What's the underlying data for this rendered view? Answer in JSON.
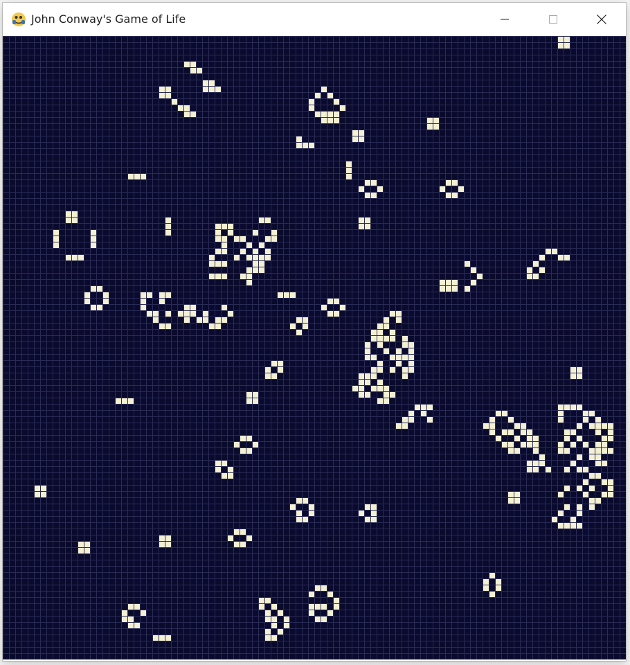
{
  "window": {
    "title": "John Conway's Game of Life",
    "app_icon": "python-icon"
  },
  "controls": {
    "minimize_icon": "minimize-icon",
    "maximize_icon": "maximize-icon",
    "close_icon": "close-icon"
  },
  "board": {
    "cols": 100,
    "rows": 100,
    "background_color": "#0a0a2e",
    "grid_color": "#2a2b55",
    "live_cell_color": "#f4f0d4",
    "live_cells": [
      [
        90,
        0
      ],
      [
        89,
        0
      ],
      [
        89,
        1
      ],
      [
        90,
        1
      ],
      [
        29,
        4
      ],
      [
        30,
        4
      ],
      [
        30,
        5
      ],
      [
        31,
        5
      ],
      [
        32,
        7
      ],
      [
        33,
        7
      ],
      [
        32,
        8
      ],
      [
        33,
        8
      ],
      [
        34,
        8
      ],
      [
        25,
        8
      ],
      [
        26,
        8
      ],
      [
        25,
        9
      ],
      [
        26,
        9
      ],
      [
        27,
        10
      ],
      [
        28,
        11
      ],
      [
        29,
        11
      ],
      [
        29,
        12
      ],
      [
        30,
        12
      ],
      [
        51,
        8
      ],
      [
        50,
        9
      ],
      [
        52,
        9
      ],
      [
        49,
        10
      ],
      [
        53,
        10
      ],
      [
        54,
        11
      ],
      [
        49,
        11
      ],
      [
        50,
        12
      ],
      [
        51,
        12
      ],
      [
        52,
        12
      ],
      [
        53,
        12
      ],
      [
        51,
        13
      ],
      [
        52,
        13
      ],
      [
        53,
        13
      ],
      [
        56,
        15
      ],
      [
        57,
        15
      ],
      [
        56,
        16
      ],
      [
        57,
        16
      ],
      [
        68,
        13
      ],
      [
        69,
        13
      ],
      [
        68,
        14
      ],
      [
        69,
        14
      ],
      [
        47,
        16
      ],
      [
        47,
        17
      ],
      [
        48,
        17
      ],
      [
        49,
        17
      ],
      [
        20,
        22
      ],
      [
        21,
        22
      ],
      [
        22,
        22
      ],
      [
        55,
        20
      ],
      [
        55,
        21
      ],
      [
        55,
        22
      ],
      [
        58,
        23
      ],
      [
        59,
        23
      ],
      [
        57,
        24
      ],
      [
        60,
        24
      ],
      [
        58,
        25
      ],
      [
        59,
        25
      ],
      [
        71,
        23
      ],
      [
        72,
        23
      ],
      [
        70,
        24
      ],
      [
        73,
        24
      ],
      [
        71,
        25
      ],
      [
        72,
        25
      ],
      [
        10,
        28
      ],
      [
        11,
        28
      ],
      [
        10,
        29
      ],
      [
        11,
        29
      ],
      [
        8,
        31
      ],
      [
        8,
        32
      ],
      [
        8,
        33
      ],
      [
        14,
        31
      ],
      [
        14,
        32
      ],
      [
        14,
        33
      ],
      [
        10,
        35
      ],
      [
        11,
        35
      ],
      [
        12,
        35
      ],
      [
        26,
        29
      ],
      [
        26,
        30
      ],
      [
        26,
        31
      ],
      [
        57,
        29
      ],
      [
        58,
        29
      ],
      [
        57,
        30
      ],
      [
        58,
        30
      ],
      [
        34,
        30
      ],
      [
        35,
        30
      ],
      [
        36,
        30
      ],
      [
        41,
        29
      ],
      [
        42,
        29
      ],
      [
        34,
        31
      ],
      [
        36,
        31
      ],
      [
        40,
        31
      ],
      [
        43,
        31
      ],
      [
        34,
        32
      ],
      [
        35,
        32
      ],
      [
        37,
        32
      ],
      [
        38,
        32
      ],
      [
        42,
        32
      ],
      [
        43,
        32
      ],
      [
        35,
        33
      ],
      [
        39,
        33
      ],
      [
        41,
        33
      ],
      [
        34,
        34
      ],
      [
        35,
        34
      ],
      [
        38,
        34
      ],
      [
        40,
        34
      ],
      [
        42,
        34
      ],
      [
        33,
        35
      ],
      [
        37,
        35
      ],
      [
        39,
        35
      ],
      [
        40,
        35
      ],
      [
        41,
        35
      ],
      [
        42,
        35
      ],
      [
        33,
        36
      ],
      [
        34,
        36
      ],
      [
        35,
        36
      ],
      [
        40,
        36
      ],
      [
        41,
        36
      ],
      [
        39,
        37
      ],
      [
        40,
        37
      ],
      [
        41,
        37
      ],
      [
        33,
        38
      ],
      [
        34,
        38
      ],
      [
        35,
        38
      ],
      [
        38,
        38
      ],
      [
        39,
        38
      ],
      [
        39,
        39
      ],
      [
        87,
        34
      ],
      [
        88,
        34
      ],
      [
        86,
        35
      ],
      [
        89,
        35
      ],
      [
        90,
        35
      ],
      [
        85,
        36
      ],
      [
        84,
        37
      ],
      [
        86,
        37
      ],
      [
        84,
        38
      ],
      [
        85,
        38
      ],
      [
        74,
        36
      ],
      [
        75,
        37
      ],
      [
        76,
        38
      ],
      [
        75,
        39
      ],
      [
        74,
        40
      ],
      [
        70,
        39
      ],
      [
        71,
        39
      ],
      [
        72,
        39
      ],
      [
        70,
        40
      ],
      [
        71,
        40
      ],
      [
        72,
        40
      ],
      [
        14,
        40
      ],
      [
        15,
        40
      ],
      [
        13,
        41
      ],
      [
        16,
        41
      ],
      [
        13,
        42
      ],
      [
        16,
        42
      ],
      [
        14,
        43
      ],
      [
        15,
        43
      ],
      [
        22,
        41
      ],
      [
        23,
        41
      ],
      [
        25,
        41
      ],
      [
        26,
        41
      ],
      [
        22,
        42
      ],
      [
        25,
        42
      ],
      [
        22,
        43
      ],
      [
        29,
        43
      ],
      [
        30,
        43
      ],
      [
        35,
        43
      ],
      [
        23,
        44
      ],
      [
        24,
        44
      ],
      [
        26,
        44
      ],
      [
        28,
        44
      ],
      [
        29,
        44
      ],
      [
        30,
        44
      ],
      [
        32,
        44
      ],
      [
        36,
        44
      ],
      [
        24,
        45
      ],
      [
        32,
        45
      ],
      [
        35,
        45
      ],
      [
        29,
        45
      ],
      [
        31,
        45
      ],
      [
        34,
        45
      ],
      [
        25,
        46
      ],
      [
        26,
        46
      ],
      [
        33,
        46
      ],
      [
        34,
        46
      ],
      [
        44,
        41
      ],
      [
        45,
        41
      ],
      [
        46,
        41
      ],
      [
        52,
        42
      ],
      [
        53,
        42
      ],
      [
        51,
        43
      ],
      [
        54,
        43
      ],
      [
        52,
        44
      ],
      [
        53,
        44
      ],
      [
        47,
        45
      ],
      [
        48,
        45
      ],
      [
        46,
        46
      ],
      [
        48,
        46
      ],
      [
        47,
        47
      ],
      [
        62,
        44
      ],
      [
        63,
        44
      ],
      [
        61,
        45
      ],
      [
        63,
        45
      ],
      [
        60,
        46
      ],
      [
        61,
        46
      ],
      [
        59,
        47
      ],
      [
        60,
        47
      ],
      [
        62,
        47
      ],
      [
        59,
        48
      ],
      [
        60,
        48
      ],
      [
        61,
        48
      ],
      [
        62,
        48
      ],
      [
        64,
        48
      ],
      [
        58,
        49
      ],
      [
        60,
        49
      ],
      [
        64,
        49
      ],
      [
        65,
        49
      ],
      [
        58,
        50
      ],
      [
        61,
        50
      ],
      [
        63,
        50
      ],
      [
        65,
        50
      ],
      [
        58,
        51
      ],
      [
        59,
        51
      ],
      [
        62,
        51
      ],
      [
        63,
        51
      ],
      [
        64,
        51
      ],
      [
        65,
        51
      ],
      [
        60,
        52
      ],
      [
        63,
        52
      ],
      [
        65,
        52
      ],
      [
        59,
        53
      ],
      [
        60,
        53
      ],
      [
        62,
        53
      ],
      [
        64,
        53
      ],
      [
        65,
        53
      ],
      [
        57,
        54
      ],
      [
        58,
        54
      ],
      [
        59,
        54
      ],
      [
        64,
        54
      ],
      [
        57,
        55
      ],
      [
        58,
        55
      ],
      [
        60,
        55
      ],
      [
        56,
        56
      ],
      [
        57,
        56
      ],
      [
        59,
        56
      ],
      [
        60,
        56
      ],
      [
        61,
        56
      ],
      [
        57,
        57
      ],
      [
        58,
        57
      ],
      [
        61,
        57
      ],
      [
        62,
        57
      ],
      [
        60,
        58
      ],
      [
        61,
        58
      ],
      [
        43,
        52
      ],
      [
        44,
        52
      ],
      [
        42,
        53
      ],
      [
        44,
        53
      ],
      [
        42,
        54
      ],
      [
        43,
        54
      ],
      [
        91,
        53
      ],
      [
        92,
        53
      ],
      [
        91,
        54
      ],
      [
        92,
        54
      ],
      [
        18,
        58
      ],
      [
        19,
        58
      ],
      [
        20,
        58
      ],
      [
        39,
        57
      ],
      [
        40,
        57
      ],
      [
        39,
        58
      ],
      [
        40,
        58
      ],
      [
        66,
        59
      ],
      [
        67,
        59
      ],
      [
        68,
        59
      ],
      [
        65,
        60
      ],
      [
        67,
        60
      ],
      [
        64,
        61
      ],
      [
        65,
        61
      ],
      [
        68,
        61
      ],
      [
        63,
        62
      ],
      [
        64,
        62
      ],
      [
        79,
        60
      ],
      [
        80,
        60
      ],
      [
        78,
        61
      ],
      [
        81,
        61
      ],
      [
        77,
        62
      ],
      [
        78,
        62
      ],
      [
        82,
        62
      ],
      [
        83,
        62
      ],
      [
        78,
        63
      ],
      [
        80,
        63
      ],
      [
        81,
        63
      ],
      [
        83,
        63
      ],
      [
        84,
        63
      ],
      [
        79,
        64
      ],
      [
        82,
        64
      ],
      [
        84,
        64
      ],
      [
        85,
        64
      ],
      [
        80,
        65
      ],
      [
        81,
        65
      ],
      [
        83,
        65
      ],
      [
        84,
        65
      ],
      [
        85,
        65
      ],
      [
        81,
        66
      ],
      [
        82,
        66
      ],
      [
        85,
        66
      ],
      [
        89,
        59
      ],
      [
        90,
        59
      ],
      [
        91,
        59
      ],
      [
        92,
        59
      ],
      [
        89,
        60
      ],
      [
        93,
        60
      ],
      [
        94,
        60
      ],
      [
        89,
        61
      ],
      [
        93,
        61
      ],
      [
        95,
        61
      ],
      [
        92,
        62
      ],
      [
        94,
        62
      ],
      [
        95,
        62
      ],
      [
        96,
        62
      ],
      [
        97,
        62
      ],
      [
        90,
        63
      ],
      [
        91,
        63
      ],
      [
        95,
        63
      ],
      [
        97,
        63
      ],
      [
        90,
        64
      ],
      [
        92,
        64
      ],
      [
        96,
        64
      ],
      [
        97,
        64
      ],
      [
        89,
        65
      ],
      [
        91,
        65
      ],
      [
        93,
        65
      ],
      [
        95,
        65
      ],
      [
        96,
        65
      ],
      [
        89,
        66
      ],
      [
        90,
        66
      ],
      [
        94,
        66
      ],
      [
        95,
        66
      ],
      [
        96,
        66
      ],
      [
        97,
        66
      ],
      [
        86,
        67
      ],
      [
        92,
        67
      ],
      [
        94,
        67
      ],
      [
        95,
        67
      ],
      [
        84,
        68
      ],
      [
        85,
        68
      ],
      [
        86,
        68
      ],
      [
        91,
        68
      ],
      [
        95,
        68
      ],
      [
        96,
        68
      ],
      [
        84,
        69
      ],
      [
        85,
        69
      ],
      [
        87,
        69
      ],
      [
        90,
        69
      ],
      [
        92,
        69
      ],
      [
        93,
        69
      ],
      [
        38,
        64
      ],
      [
        39,
        64
      ],
      [
        37,
        65
      ],
      [
        40,
        65
      ],
      [
        38,
        66
      ],
      [
        39,
        66
      ],
      [
        34,
        68
      ],
      [
        35,
        68
      ],
      [
        34,
        69
      ],
      [
        36,
        69
      ],
      [
        35,
        70
      ],
      [
        36,
        70
      ],
      [
        94,
        70
      ],
      [
        95,
        70
      ],
      [
        93,
        71
      ],
      [
        96,
        71
      ],
      [
        97,
        71
      ],
      [
        90,
        72
      ],
      [
        92,
        72
      ],
      [
        94,
        72
      ],
      [
        97,
        72
      ],
      [
        89,
        73
      ],
      [
        93,
        73
      ],
      [
        96,
        73
      ],
      [
        97,
        73
      ],
      [
        94,
        74
      ],
      [
        95,
        74
      ],
      [
        90,
        75
      ],
      [
        92,
        75
      ],
      [
        94,
        75
      ],
      [
        89,
        76
      ],
      [
        92,
        76
      ],
      [
        88,
        77
      ],
      [
        91,
        77
      ],
      [
        89,
        78
      ],
      [
        90,
        78
      ],
      [
        91,
        78
      ],
      [
        92,
        78
      ],
      [
        5,
        72
      ],
      [
        6,
        72
      ],
      [
        5,
        73
      ],
      [
        6,
        73
      ],
      [
        81,
        73
      ],
      [
        82,
        73
      ],
      [
        81,
        74
      ],
      [
        82,
        74
      ],
      [
        47,
        74
      ],
      [
        48,
        74
      ],
      [
        46,
        75
      ],
      [
        49,
        75
      ],
      [
        47,
        76
      ],
      [
        49,
        76
      ],
      [
        47,
        77
      ],
      [
        48,
        77
      ],
      [
        58,
        75
      ],
      [
        59,
        75
      ],
      [
        57,
        76
      ],
      [
        59,
        76
      ],
      [
        58,
        77
      ],
      [
        59,
        77
      ],
      [
        37,
        79
      ],
      [
        38,
        79
      ],
      [
        36,
        80
      ],
      [
        39,
        80
      ],
      [
        37,
        81
      ],
      [
        38,
        81
      ],
      [
        25,
        80
      ],
      [
        26,
        80
      ],
      [
        25,
        81
      ],
      [
        26,
        81
      ],
      [
        12,
        81
      ],
      [
        13,
        81
      ],
      [
        12,
        82
      ],
      [
        13,
        82
      ],
      [
        78,
        86
      ],
      [
        77,
        87
      ],
      [
        79,
        87
      ],
      [
        77,
        88
      ],
      [
        79,
        88
      ],
      [
        78,
        89
      ],
      [
        50,
        88
      ],
      [
        51,
        88
      ],
      [
        49,
        89
      ],
      [
        52,
        89
      ],
      [
        53,
        90
      ],
      [
        49,
        91
      ],
      [
        50,
        91
      ],
      [
        51,
        91
      ],
      [
        53,
        91
      ],
      [
        49,
        92
      ],
      [
        52,
        92
      ],
      [
        50,
        93
      ],
      [
        51,
        93
      ],
      [
        41,
        90
      ],
      [
        42,
        90
      ],
      [
        41,
        91
      ],
      [
        43,
        91
      ],
      [
        42,
        92
      ],
      [
        44,
        92
      ],
      [
        42,
        93
      ],
      [
        43,
        93
      ],
      [
        45,
        93
      ],
      [
        43,
        94
      ],
      [
        45,
        94
      ],
      [
        42,
        95
      ],
      [
        44,
        95
      ],
      [
        42,
        96
      ],
      [
        43,
        96
      ],
      [
        20,
        91
      ],
      [
        21,
        91
      ],
      [
        19,
        92
      ],
      [
        22,
        92
      ],
      [
        20,
        93
      ],
      [
        19,
        93
      ],
      [
        20,
        94
      ],
      [
        21,
        94
      ],
      [
        24,
        96
      ],
      [
        25,
        96
      ],
      [
        26,
        96
      ]
    ]
  }
}
